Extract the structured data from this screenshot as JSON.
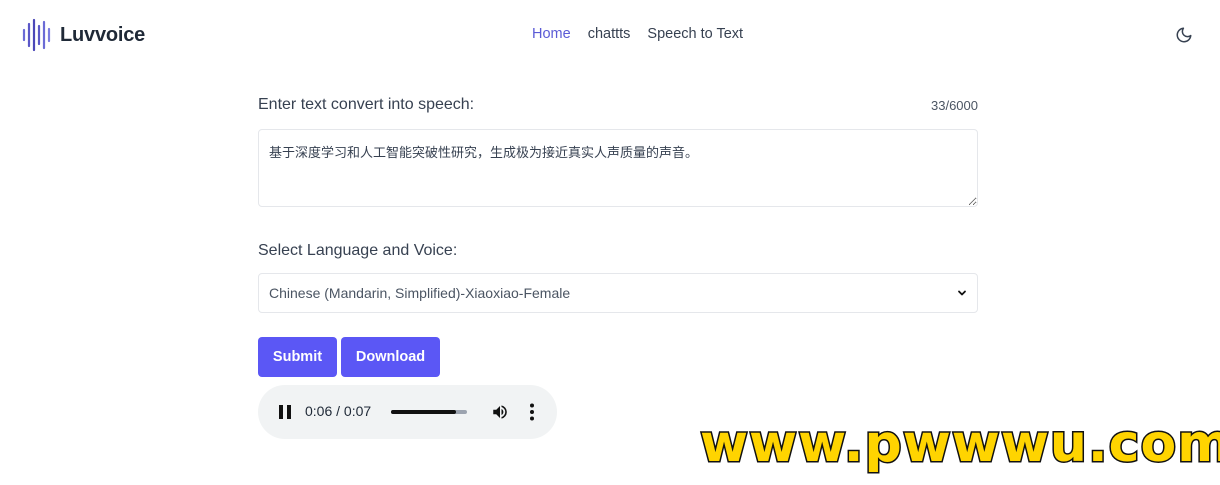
{
  "brand": {
    "name": "Luvvoice"
  },
  "nav": {
    "items": [
      {
        "label": "Home",
        "active": true
      },
      {
        "label": "chattts",
        "active": false
      },
      {
        "label": "Speech to Text",
        "active": false
      }
    ],
    "theme_icon": "moon-icon"
  },
  "form": {
    "text_label": "Enter text convert into speech:",
    "char_count": "33/6000",
    "text_value": "基于深度学习和人工智能突破性研究，生成极为接近真实人声质量的声音。",
    "voice_label": "Select Language and Voice:",
    "voice_selected": "Chinese (Mandarin, Simplified)-Xiaoxiao-Female",
    "submit_label": "Submit",
    "download_label": "Download"
  },
  "audio": {
    "time_display": "0:06 / 0:07",
    "progress_fraction": 0.857
  },
  "watermark": {
    "text": "www.pwwwu.com"
  },
  "colors": {
    "accent": "#5b57f5",
    "nav_active": "#5b5bd6",
    "watermark": "#ffd400"
  }
}
